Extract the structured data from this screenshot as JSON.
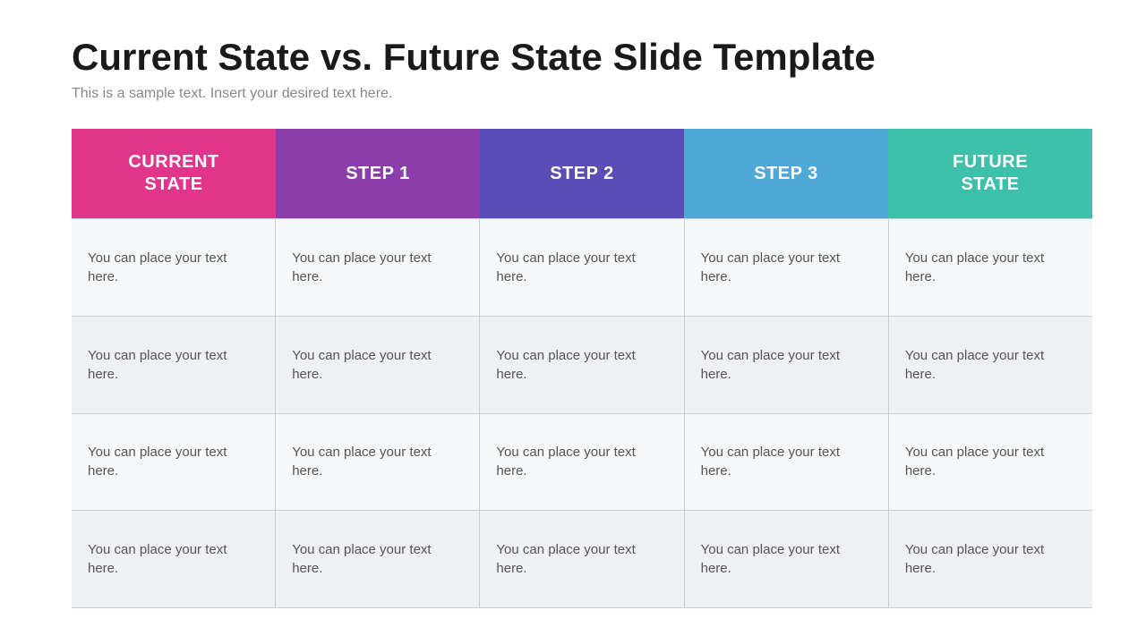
{
  "page": {
    "title": "Current State vs. Future State Slide Template",
    "subtitle": "This is a sample text. Insert your desired text here."
  },
  "header": {
    "columns": [
      {
        "id": "current-state",
        "label": "CURRENT\nSTATE",
        "class": "current-state"
      },
      {
        "id": "step1",
        "label": "STEP 1",
        "class": "step1"
      },
      {
        "id": "step2",
        "label": "STEP 2",
        "class": "step2"
      },
      {
        "id": "step3",
        "label": "STEP 3",
        "class": "step3"
      },
      {
        "id": "future-state",
        "label": "FUTURE\nSTATE",
        "class": "future-state"
      }
    ]
  },
  "rows": [
    [
      "You can place your text here.",
      "You can place your text here.",
      "You can place your text here.",
      "You can place your text here.",
      "You can place your text here."
    ],
    [
      "You can place your text here.",
      "You can place your text here.",
      "You can place your text here.",
      "You can place your text here.",
      "You can place your text here."
    ],
    [
      "You can place your text here.",
      "You can place your text here.",
      "You can place your text here.",
      "You can place your text here.",
      "You can place your text here."
    ],
    [
      "You can place your text here.",
      "You can place your text here.",
      "You can place your text here.",
      "You can place your text here.",
      "You can place your text here."
    ]
  ]
}
